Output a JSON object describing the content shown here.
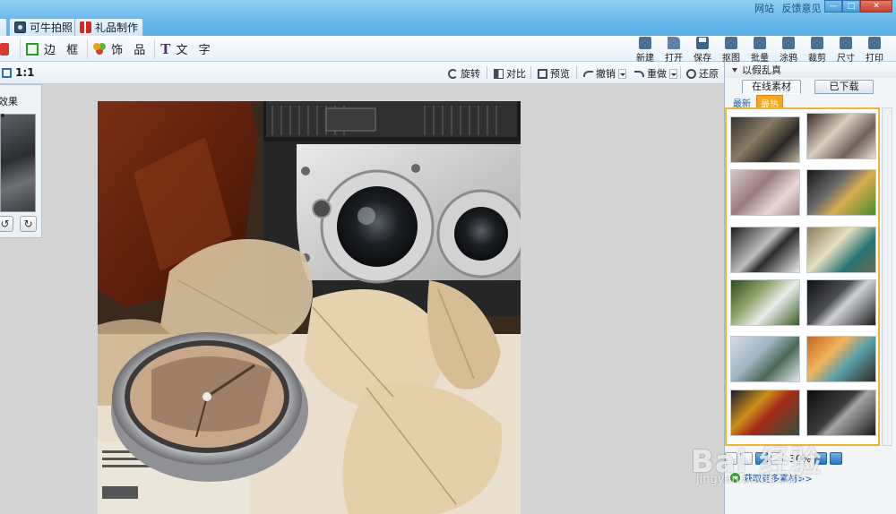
{
  "titlebar": {
    "links": [
      "网站",
      "反馈意见"
    ],
    "tabs": [
      {
        "label": "可牛拍照",
        "icon": "camera-icon"
      },
      {
        "label": "礼品制作",
        "icon": "gift-icon"
      }
    ]
  },
  "toolbar_left": {
    "items": [
      {
        "label": "边 框",
        "icon": "frame-icon"
      },
      {
        "label": "饰 品",
        "icon": "clover-icon"
      },
      {
        "label": "文 字",
        "icon": "text-icon",
        "icon_text": "T"
      }
    ]
  },
  "toolbar_right": {
    "items": [
      {
        "label": "新建",
        "icon": "new-file-icon"
      },
      {
        "label": "打开",
        "icon": "open-folder-icon"
      },
      {
        "label": "保存",
        "icon": "save-icon"
      },
      {
        "label": "抠图",
        "icon": "cutout-icon"
      },
      {
        "label": "批量",
        "icon": "batch-icon"
      },
      {
        "label": "涂鸦",
        "icon": "doodle-icon"
      },
      {
        "label": "裁剪",
        "icon": "crop-icon"
      },
      {
        "label": "尺寸",
        "icon": "resize-icon"
      },
      {
        "label": "打印",
        "icon": "print-icon"
      }
    ]
  },
  "canvas_toolbar": {
    "zoom": "1:1",
    "rotate": "旋转",
    "compare": "对比",
    "preview": "预览",
    "undo": "撤销",
    "redo": "重做",
    "reset": "还原"
  },
  "effect_panel": {
    "title": "效果"
  },
  "material_panel": {
    "title": "以假乱真",
    "tabs": [
      "在线素材",
      "已下载"
    ],
    "subtabs": [
      "最新",
      "最热"
    ],
    "pager_text": "30%",
    "more_link": "获取更多素材>>"
  },
  "watermark": {
    "brand": "Bai 经验",
    "url": "jingyan.baidu.com"
  },
  "colors": {
    "titlebar": "#68b8ea",
    "accent_orange": "#f5a623",
    "link_blue": "#1b4fa3"
  }
}
